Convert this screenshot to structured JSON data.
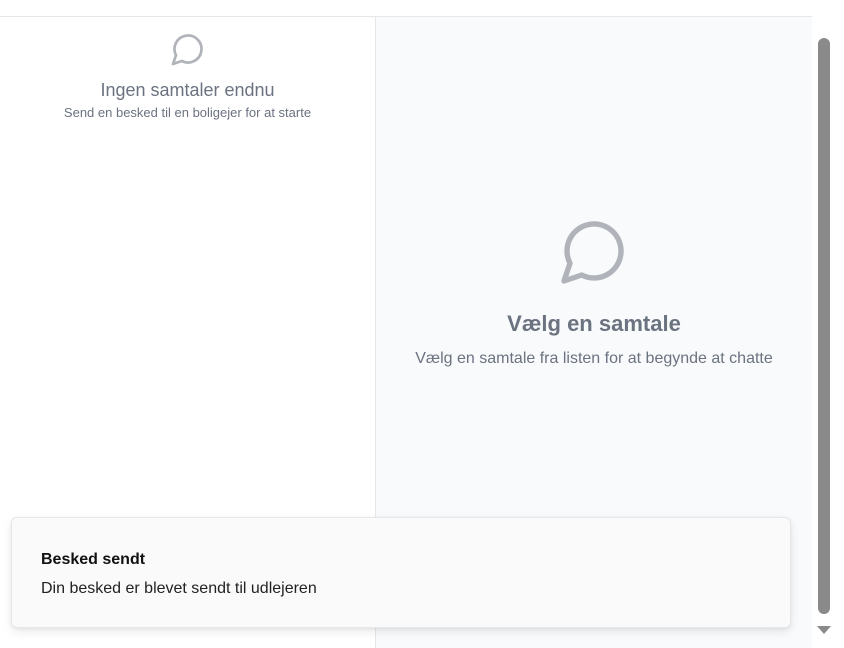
{
  "conversations": {
    "empty_title": "Ingen samtaler endnu",
    "empty_subtitle": "Send en besked til en boligejer for at starte",
    "icon": "chat-bubble-icon"
  },
  "chat": {
    "empty_title": "Vælg en samtale",
    "empty_subtitle": "Vælg en samtale fra listen for at begynde at chatte",
    "icon": "chat-bubble-icon"
  },
  "toast": {
    "title": "Besked sendt",
    "description": "Din besked er blevet sendt til udlejeren"
  },
  "colors": {
    "muted_text": "#6b7280",
    "icon": "#9ca3af",
    "panel_bg": "#f9fafb",
    "border": "#e5e7eb"
  }
}
